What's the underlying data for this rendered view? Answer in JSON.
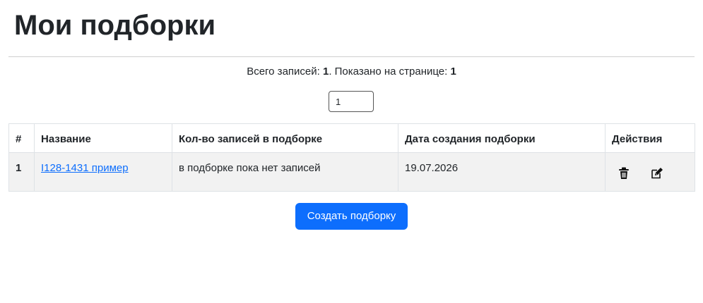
{
  "page": {
    "title": "Мои подборки"
  },
  "summary": {
    "total_label": "Всего записей: ",
    "total_value": "1",
    "shown_label": ". Показано на странице: ",
    "shown_value": "1"
  },
  "pagination": {
    "current_page": "1"
  },
  "table": {
    "headers": {
      "number": "#",
      "name": "Название",
      "count": "Кол-во записей в подборке",
      "created": "Дата создания подборки",
      "actions": "Действия"
    },
    "rows": [
      {
        "number": "1",
        "name": "I128-1431 пример",
        "count": "в подборке пока нет записей",
        "created": "19.07.2026",
        "actions": [
          "trash-icon",
          "edit-icon"
        ]
      }
    ]
  },
  "buttons": {
    "create": "Создать подборку"
  },
  "colors": {
    "primary": "#0d6efd",
    "text": "#212529",
    "row_background": "#f2f2f2",
    "border": "#dee2e6"
  }
}
